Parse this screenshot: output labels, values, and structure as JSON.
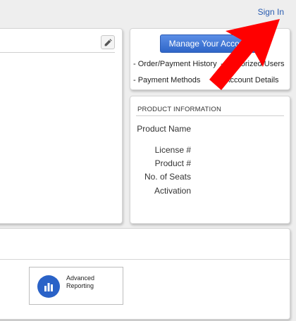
{
  "header": {
    "sign_in_label": "Sign In"
  },
  "account": {
    "manage_button": "Manage Your Account",
    "links": [
      {
        "label": "- Order/Payment History"
      },
      {
        "label": "- Authorized Users"
      },
      {
        "label": "- Payment Methods"
      },
      {
        "label": "- Account Details"
      }
    ]
  },
  "product_info": {
    "heading": "PRODUCT INFORMATION",
    "labels": [
      "Product Name",
      "License #",
      "Product #",
      "No. of Seats",
      "Activation"
    ]
  },
  "tiles": [
    {
      "line1": "Advanced",
      "line2": "Reporting",
      "icon": "bar-chart-icon"
    }
  ],
  "colors": {
    "accent": "#2f66c8",
    "link": "#2a5db0",
    "arrow": "#ff0000"
  }
}
